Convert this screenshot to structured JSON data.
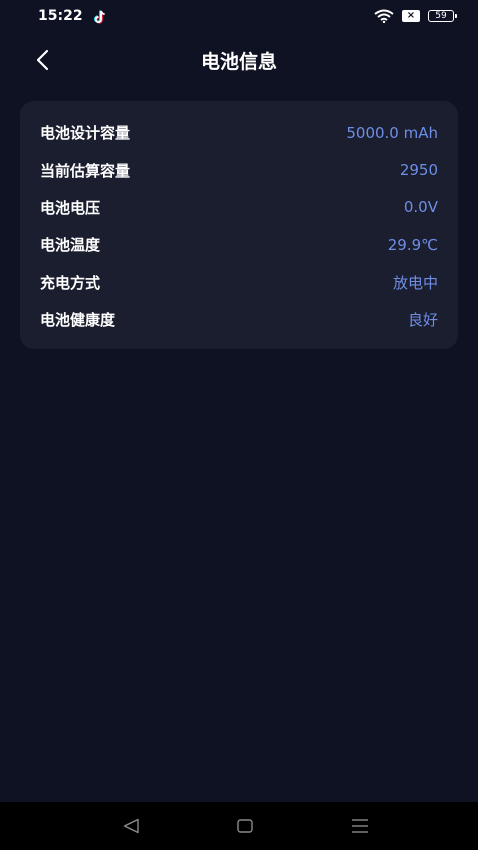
{
  "status_bar": {
    "time": "15:22",
    "battery_level": "59",
    "sim_badge": "×"
  },
  "header": {
    "title": "电池信息"
  },
  "battery_info": {
    "rows": [
      {
        "label": "电池设计容量",
        "value": "5000.0 mAh"
      },
      {
        "label": "当前估算容量",
        "value": "2950"
      },
      {
        "label": "电池电压",
        "value": "0.0V"
      },
      {
        "label": "电池温度",
        "value": "29.9℃"
      },
      {
        "label": "充电方式",
        "value": "放电中"
      },
      {
        "label": "电池健康度",
        "value": "良好"
      }
    ]
  },
  "colors": {
    "background": "#0f1222",
    "card": "#1b1e2f",
    "value_accent": "#6e8ee6"
  },
  "icons": {
    "status": [
      "tiktok-icon",
      "wifi-icon",
      "sim-icon",
      "battery-icon"
    ],
    "header": [
      "back-arrow-icon"
    ],
    "navigation": [
      "nav-back-icon",
      "nav-home-icon",
      "nav-menu-icon"
    ]
  }
}
